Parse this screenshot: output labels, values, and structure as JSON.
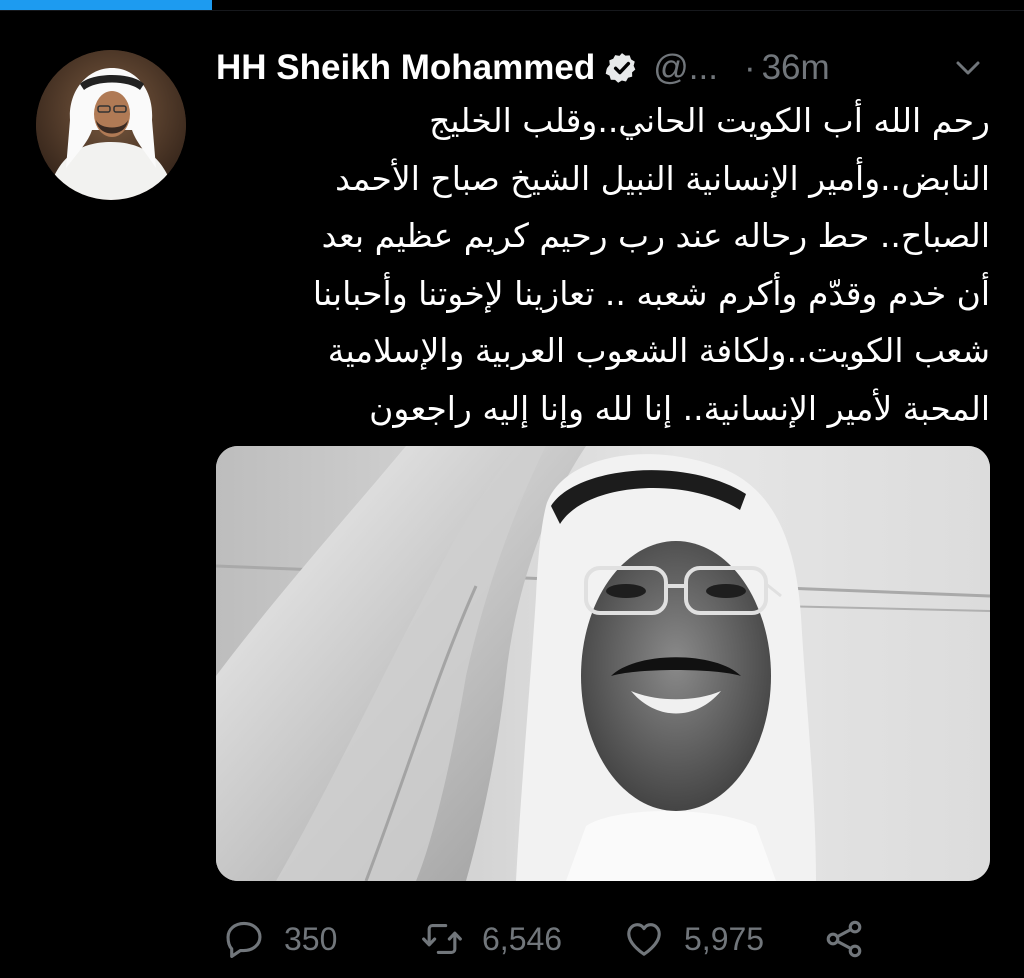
{
  "tweet": {
    "author": {
      "display_name": "HH Sheikh Mohammed",
      "handle": "@...",
      "verified": true,
      "avatar_icon": "profile-photo"
    },
    "separator": "·",
    "timestamp": "36m",
    "text_lines": [
      "رحم الله أب الكويت الحاني..وقلب الخليج",
      "النابض..وأمير الإنسانية النبيل الشيخ صباح الأحمد",
      "الصباح.. حط رحاله عند رب رحيم كريم عظيم بعد",
      "أن خدم وقدّم وأكرم شعبه .. تعازينا لإخوتنا وأحبابنا",
      "شعب الكويت..ولكافة الشعوب العربية والإسلامية",
      "المحبة لأمير الإنسانية.. إنا لله وإنا إليه راجعون"
    ],
    "media": {
      "type": "photo",
      "style": "black-and-white"
    },
    "actions": {
      "reply": {
        "icon": "reply-icon",
        "count": "350"
      },
      "retweet": {
        "icon": "retweet-icon",
        "count": "6,546"
      },
      "like": {
        "icon": "heart-icon",
        "count": "5,975"
      },
      "share": {
        "icon": "share-icon"
      }
    }
  },
  "colors": {
    "background": "#000000",
    "text_primary": "#ffffff",
    "text_secondary": "#71767b",
    "accent": "#1d9bf0"
  },
  "top_progress": {
    "fraction": 0.21
  }
}
